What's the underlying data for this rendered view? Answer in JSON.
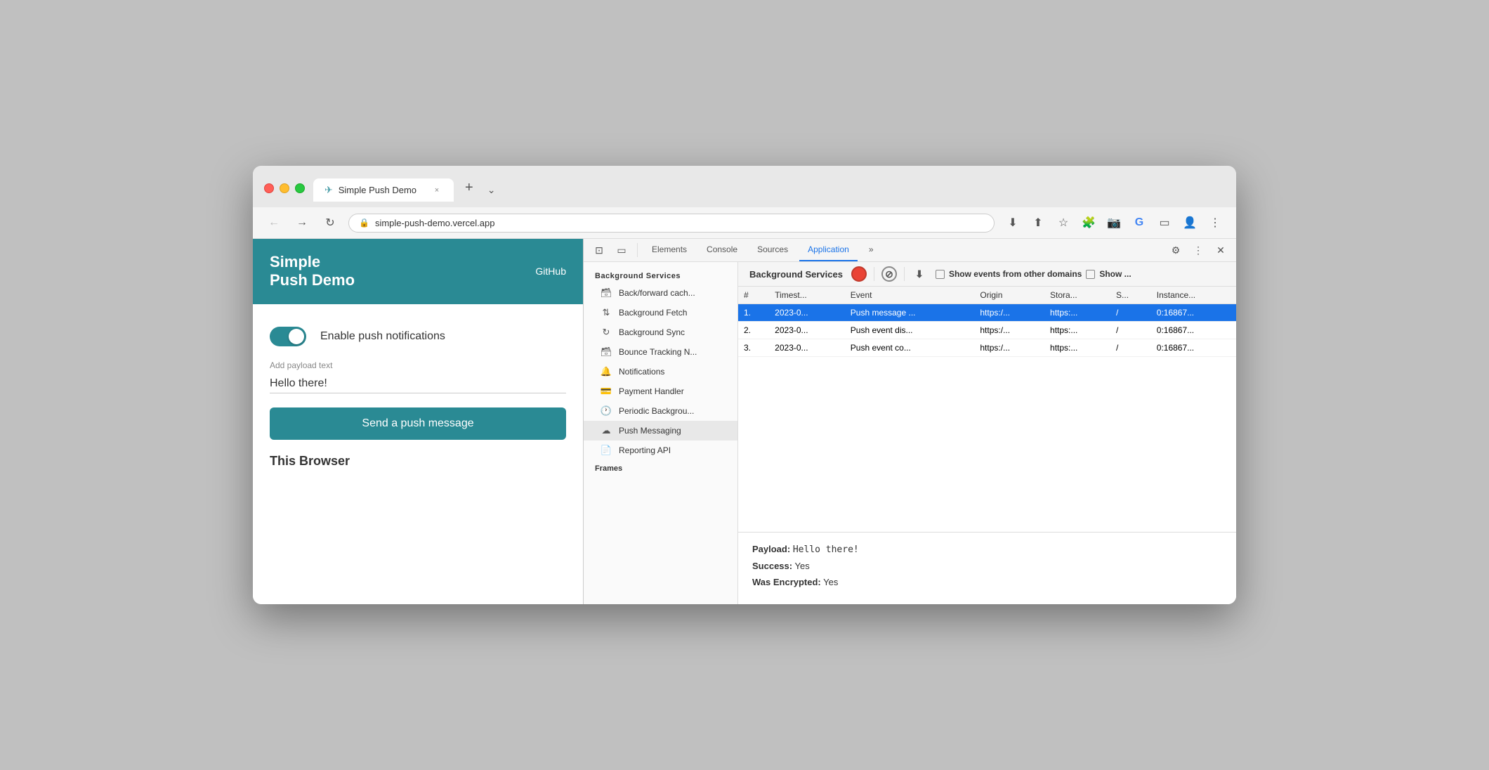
{
  "browser": {
    "tab": {
      "title": "Simple Push Demo",
      "icon": "✈",
      "close": "×",
      "new_tab": "+"
    },
    "address": "simple-push-demo.vercel.app",
    "end_button": "⌄"
  },
  "website": {
    "header": {
      "title_line1": "Simple",
      "title_line2": "Push Demo",
      "github": "GitHub"
    },
    "toggle": {
      "label": "Enable push notifications",
      "enabled": true
    },
    "payload": {
      "label": "Add payload text",
      "value": "Hello there!"
    },
    "send_button": "Send a push message",
    "this_browser_label": "This Browser"
  },
  "devtools": {
    "tabs": [
      {
        "label": "Elements",
        "active": false
      },
      {
        "label": "Console",
        "active": false
      },
      {
        "label": "Sources",
        "active": false
      },
      {
        "label": "Application",
        "active": true
      },
      {
        "label": "»",
        "active": false
      }
    ],
    "sidebar": {
      "background_services_label": "Background Services",
      "items": [
        {
          "label": "Back/forward cach...",
          "icon": "🗃"
        },
        {
          "label": "Background Fetch",
          "icon": "↑↓"
        },
        {
          "label": "Background Sync",
          "icon": "↻"
        },
        {
          "label": "Bounce Tracking N...",
          "icon": "🗃"
        },
        {
          "label": "Notifications",
          "icon": "🔔"
        },
        {
          "label": "Payment Handler",
          "icon": "💳"
        },
        {
          "label": "Periodic Backgrou...",
          "icon": "🕐"
        },
        {
          "label": "Push Messaging",
          "icon": "☁",
          "active": true
        },
        {
          "label": "Reporting API",
          "icon": "📄"
        }
      ],
      "frames_label": "Frames"
    },
    "push_messaging": {
      "title": "Background Services",
      "show_events_label": "Show events from other domains",
      "show_label": "Show ...",
      "columns": [
        "#",
        "Timest...",
        "Event",
        "Origin",
        "Stora...",
        "S...",
        "Instance..."
      ],
      "rows": [
        {
          "num": "1.",
          "timestamp": "2023-0...",
          "event": "Push message ...",
          "origin": "https:/...",
          "storage": "https:...",
          "s": "/",
          "instance": "0:16867...",
          "selected": true
        },
        {
          "num": "2.",
          "timestamp": "2023-0...",
          "event": "Push event dis...",
          "origin": "https:/...",
          "storage": "https:...",
          "s": "/",
          "instance": "0:16867...",
          "selected": false
        },
        {
          "num": "3.",
          "timestamp": "2023-0...",
          "event": "Push event co...",
          "origin": "https:/...",
          "storage": "https:...",
          "s": "/",
          "instance": "0:16867...",
          "selected": false
        }
      ],
      "detail": {
        "payload_key": "Payload:",
        "payload_value": "Hello there!",
        "success_key": "Success:",
        "success_value": "Yes",
        "encrypted_key": "Was Encrypted:",
        "encrypted_value": "Yes"
      }
    }
  }
}
